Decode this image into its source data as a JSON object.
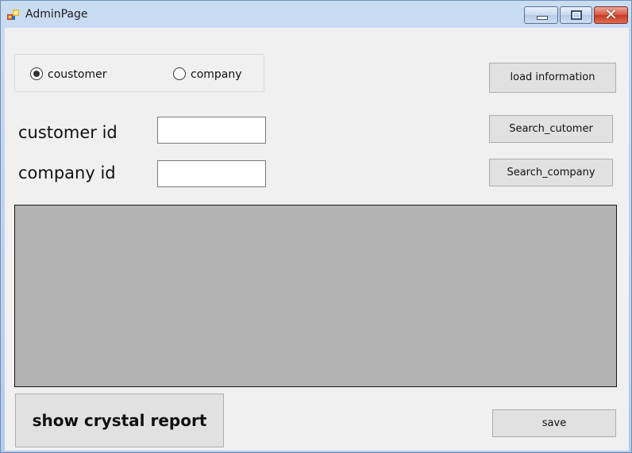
{
  "window": {
    "title": "AdminPage",
    "close_glyph": "✕"
  },
  "radio_group": {
    "options": [
      {
        "label": "coustomer",
        "selected": true
      },
      {
        "label": "company",
        "selected": false
      }
    ]
  },
  "labels": {
    "customer_id": "customer id",
    "company_id": "company id"
  },
  "inputs": {
    "customer_id_value": "",
    "company_id_value": ""
  },
  "buttons": {
    "load_information": "load information",
    "search_customer": "Search_cutomer",
    "search_company": "Search_company",
    "show_crystal_report": "show crystal report",
    "save": "save"
  },
  "icons": {
    "app": "app-icon",
    "minimize": "minimize-icon",
    "maximize": "maximize-icon",
    "close": "close-icon"
  },
  "colors": {
    "form_background": "#f0f0f0",
    "grid_background": "#b3b3b3",
    "button_face": "#e1e1e1",
    "close_button": "#c63a24"
  }
}
